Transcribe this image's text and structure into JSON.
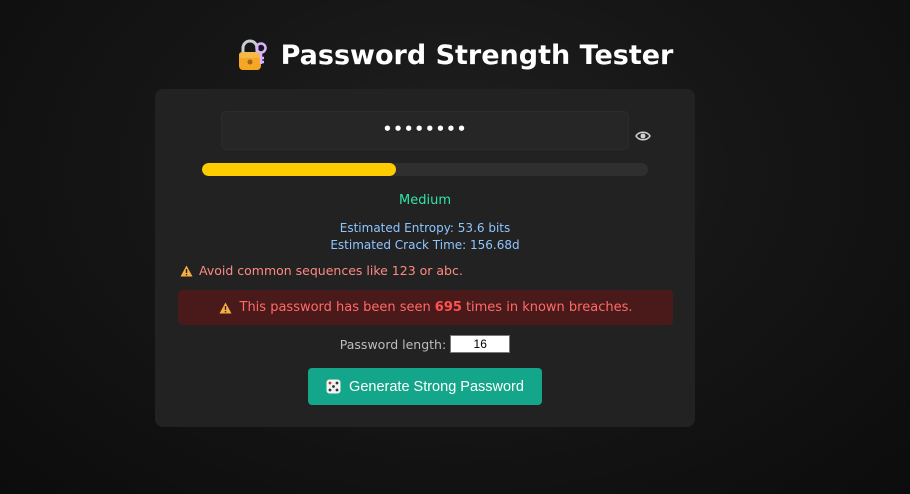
{
  "header": {
    "title": "Password Strength Tester",
    "icon": "lock-with-key-icon"
  },
  "password": {
    "value": "••••••••",
    "visibility_icon": "eye-icon"
  },
  "meter": {
    "percent": 43.5,
    "color": "#ffcc00"
  },
  "strength": {
    "label": "Medium",
    "color": "#2ee6a6"
  },
  "stats": {
    "entropy": "Estimated Entropy: 53.6 bits",
    "crack_time": "Estimated Crack Time: 156.68d"
  },
  "warning": {
    "text": "Avoid common sequences like 123 or abc."
  },
  "breach": {
    "prefix": "This password has been seen",
    "count": "695",
    "suffix": "times in known breaches."
  },
  "length": {
    "label": "Password length:",
    "value": "16"
  },
  "generate": {
    "label": "Generate Strong Password",
    "icon": "dice-icon",
    "color": "#14a68a"
  }
}
